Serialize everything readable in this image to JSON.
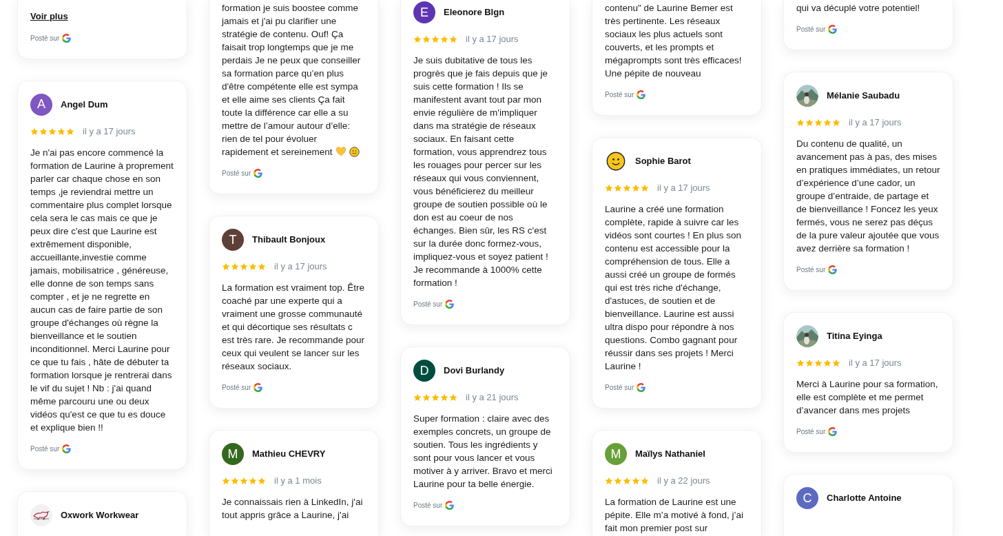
{
  "columns": [
    {
      "cards": [
        {
          "link": "Voir plus",
          "posted": "Posté sur"
        },
        {
          "name": "Angel Dum",
          "avatar": {
            "kind": "letter",
            "initial": "A",
            "color": "#7e57c2"
          },
          "stars": 5,
          "date": "il y a 17 jours",
          "text": "Je n'ai pas encore commencé la formation de Laurine à proprement parler car chaque chose en son temps ,je reviendrai mettre un commentaire plus complet lorsque cela sera le cas mais ce que je peux dire c'est que Laurine est extrêmement disponible, accueillante,investie comme jamais, mobilisatrice , généreuse, elle donne de son temps sans compter , et je ne regrette en aucun cas de faire partie de son groupe d'échanges où règne la bienveillance et le soutien inconditionnel. Merci Laurine pour ce que tu fais , hâte de débuter ta formation lorsque je rentrerai dans le vif du sujet ! Nb : j'ai quand même parcouru une ou deux vidéos qu'est ce que tu es douce et explique bien !!",
          "posted": "Posté sur"
        },
        {
          "name": "Oxwork Workwear",
          "avatar": {
            "kind": "logo"
          }
        }
      ]
    },
    {
      "cards": [
        {
          "text": "formation je suis boostee comme jamais et j'ai pu clarifier une stratégie de contenu. Ouf! Ça faisait trop longtemps que je me perdais Je ne peux que conseiller sa formation parce qu’en plus d'être compétente elle est sympa et elle aime ses clients Ça fait toute la différence car elle a su mettre de l’amour autour d’elle: rien de tel pour évoluer rapidement et sereinement",
          "trailing_icons": [
            {
              "kind": "heart"
            },
            {
              "kind": "smile"
            }
          ],
          "posted": "Posté sur"
        },
        {
          "name": "Thibault Bonjoux",
          "avatar": {
            "kind": "letter",
            "initial": "T",
            "color": "#5d4037"
          },
          "stars": 5,
          "date": "il y a 17 jours",
          "text": "La formation est vraiment top. Être coaché par une experte qui a vraiment une grosse communauté et qui décortique ses résultats c est très rare. Je recommande pour ceux qui veulent se lancer sur les réseaux sociaux.",
          "posted": "Posté sur"
        },
        {
          "name": "Mathieu CHEVRY",
          "avatar": {
            "kind": "letter",
            "initial": "M",
            "color": "#33691e"
          },
          "stars": 5,
          "date": "il y a 1 mois",
          "text": "Je connaissais rien à LinkedIn, j'ai tout appris grâce a Laurine, j'ai"
        }
      ]
    },
    {
      "cards": [
        {
          "name": "Eleonore Blgn",
          "avatar": {
            "kind": "letter",
            "initial": "E",
            "color": "#5e35b1"
          },
          "stars": 5,
          "date": "il y a 17 jours",
          "text": "Je suis dubitative de tous les progrès que je fais depuis que je suis cette formation ! Ils se manifestent avant tout par mon envie régulière de m'impliquer dans ma stratégie de réseaux sociaux. En faisant cette formation, vous apprendrez tous les rouages pour percer sur les réseaux qui vous conviennent, vous bénéficierez du meilleur groupe de soutien possible où le don est au coeur de nos échanges. Bien sûr, les RS c'est sur la durée donc formez-vous, impliquez-vous et soyez patient ! Je recommande à 1000% cette formation !",
          "posted": "Posté sur"
        },
        {
          "name": "Dovi Burlandy",
          "avatar": {
            "kind": "letter",
            "initial": "D",
            "color": "#004d40"
          },
          "stars": 5,
          "date": "il y a 21 jours",
          "text": "Super formation : claire avec des exemples concrets, un groupe de soutien. Tous les ingrédients y sont pour vous lancer et vous motiver à y arriver. Bravo et merci Laurine pour ta belle énergie.",
          "posted": "Posté sur"
        }
      ]
    },
    {
      "cards": [
        {
          "text": "contenu\" de Laurine Bemer est très pertinente. Les réseaux sociaux les plus actuels sont couverts, et les prompts et mégaprompts sont très efficaces! Une pépite de nouveau",
          "posted": "Posté sur"
        },
        {
          "name": "Sophie Barot",
          "avatar": {
            "kind": "smiley"
          },
          "stars": 5,
          "date": "il y a 17 jours",
          "text": "Laurine a créé une formation complète, rapide à suivre car les vidéos sont courtes ! En plus son contenu est accessible pour la compréhension de tous. Elle a aussi créé un groupe de formés qui est très riche d'échange, d'astuces, de soutien et de bienveillance. Laurine est aussi ultra dispo pour répondre à nos questions. Combo gagnant pour réussir dans ses projets ! Merci Laurine !",
          "posted": "Posté sur"
        },
        {
          "name": "Maïlys Nathaniel",
          "avatar": {
            "kind": "letter",
            "initial": "M",
            "color": "#689f38"
          },
          "stars": 5,
          "date": "il y a 22 jours",
          "text": "La formation de Laurine est une pépite. Elle m’a motivé à fond, j’ai fait mon premier post sur"
        }
      ]
    },
    {
      "cards": [
        {
          "text": "qui va décuplé votre potentiel!",
          "posted": "Posté sur"
        },
        {
          "name": "Mélanie Saubadu",
          "stars": 5,
          "date": "il y a 17 jours",
          "text": "Du contenu de qualité, un avancement pas à pas, des mises en pratiques immédiates, un retour d’expérience d’une cador, un groupe d’entraide, de partage et de bienveillance ! Foncez les yeux fermés, vous ne serez pas déçus de la pure valeur ajoutée que vous avez derrière sa formation !",
          "posted": "Posté sur"
        },
        {
          "name": "Titina Eyinga",
          "stars": 5,
          "date": "il y a 17 jours",
          "text": "Merci à Laurine pour sa formation, elle est complète et me permet d’avancer dans mes projets",
          "posted": "Posté sur"
        },
        {
          "name": "Charlotte Antoine",
          "avatar": {
            "kind": "letter",
            "initial": "C",
            "color": "#5c6bc0"
          }
        }
      ]
    }
  ]
}
